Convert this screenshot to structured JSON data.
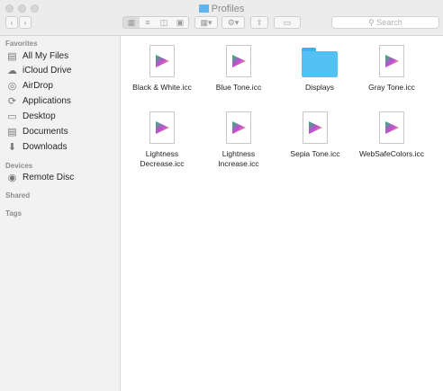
{
  "window": {
    "title": "Profiles"
  },
  "toolbar": {
    "back_icon": "chevron-left-icon",
    "forward_icon": "chevron-right-icon",
    "view_modes": [
      "icon-view",
      "list-view",
      "column-view",
      "cover-flow-view"
    ],
    "search_placeholder": "Search"
  },
  "sidebar": {
    "favorites_label": "Favorites",
    "favorites": [
      {
        "label": "All My Files",
        "icon": "all-files-icon"
      },
      {
        "label": "iCloud Drive",
        "icon": "cloud-icon"
      },
      {
        "label": "AirDrop",
        "icon": "airdrop-icon"
      },
      {
        "label": "Applications",
        "icon": "applications-icon"
      },
      {
        "label": "Desktop",
        "icon": "desktop-icon"
      },
      {
        "label": "Documents",
        "icon": "documents-icon"
      },
      {
        "label": "Downloads",
        "icon": "downloads-icon"
      }
    ],
    "devices_label": "Devices",
    "devices": [
      {
        "label": "Remote Disc",
        "icon": "disc-icon"
      }
    ],
    "shared_label": "Shared",
    "tags_label": "Tags"
  },
  "files": [
    {
      "name_lines": [
        "Black & White.icc"
      ],
      "type": "icc"
    },
    {
      "name_lines": [
        "Blue Tone.icc"
      ],
      "type": "icc"
    },
    {
      "name_lines": [
        "Displays"
      ],
      "type": "folder"
    },
    {
      "name_lines": [
        "Gray Tone.icc"
      ],
      "type": "icc"
    },
    {
      "name_lines": [
        "Lightness",
        "Decrease.icc"
      ],
      "type": "icc"
    },
    {
      "name_lines": [
        "Lightness",
        "Increase.icc"
      ],
      "type": "icc"
    },
    {
      "name_lines": [
        "Sepia Tone.icc"
      ],
      "type": "icc"
    },
    {
      "name_lines": [
        "WebSafeColors.icc"
      ],
      "type": "icc"
    }
  ],
  "colors": {
    "folder": "#53c1f4",
    "sidebar_bg": "#f2f2f2",
    "toolbar_bg": "#ececec"
  }
}
